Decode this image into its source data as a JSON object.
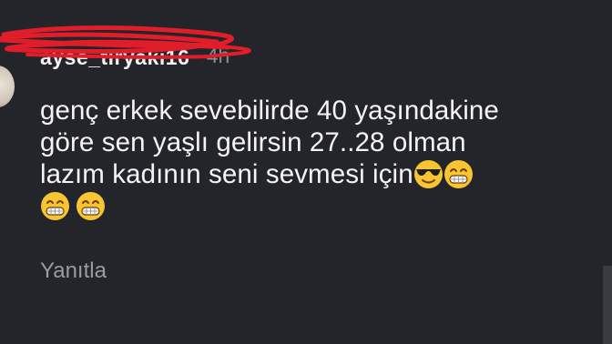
{
  "comment": {
    "username": "ayse_tiryaki16",
    "timestamp": "4h",
    "lines": [
      "genç erkek sevebilirde 40 yaşındakine",
      "göre sen yaşlı gelirsin 27..28 olman",
      "lazım kadının seni sevmesi için"
    ],
    "emojis_line3": [
      "smiling-face-with-sunglasses",
      "grinning-face-with-smiling-eyes"
    ],
    "emojis_line4": [
      "grinning-face-with-smiling-eyes",
      "grinning-face-with-smiling-eyes"
    ],
    "reply_label": "Yanıtla"
  },
  "colors": {
    "background": "#24252a",
    "text": "#f4f4f4",
    "muted": "#8c8d92",
    "scribble": "#e11d2a"
  }
}
